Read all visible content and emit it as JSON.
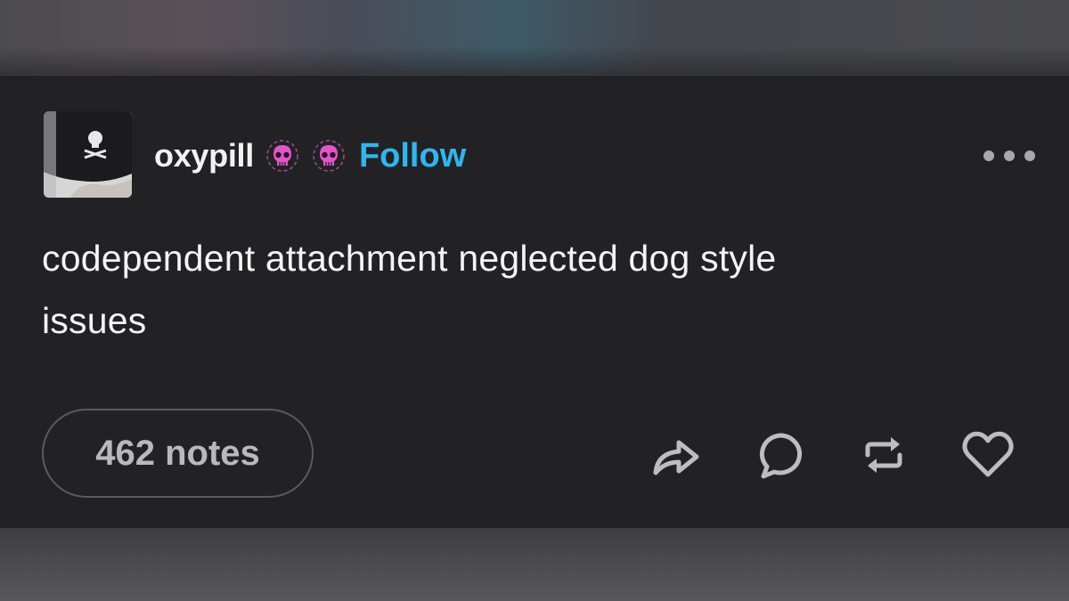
{
  "post": {
    "username": "oxypill",
    "follow_label": "Follow",
    "badges": [
      "skull-badge-icon",
      "skull-badge-icon"
    ],
    "body_lines": [
      "codependent attachment neglected dog style",
      "issues"
    ],
    "notes_label": "462 notes",
    "actions": [
      "share-icon",
      "reply-icon",
      "reblog-icon",
      "like-icon"
    ],
    "more_icon": "more-options-icon"
  },
  "colors": {
    "background": "#222224",
    "text": "#f4f4f4",
    "follow": "#2fb6ee",
    "icon": "#bdbdbf",
    "badge": "#e455c8"
  }
}
